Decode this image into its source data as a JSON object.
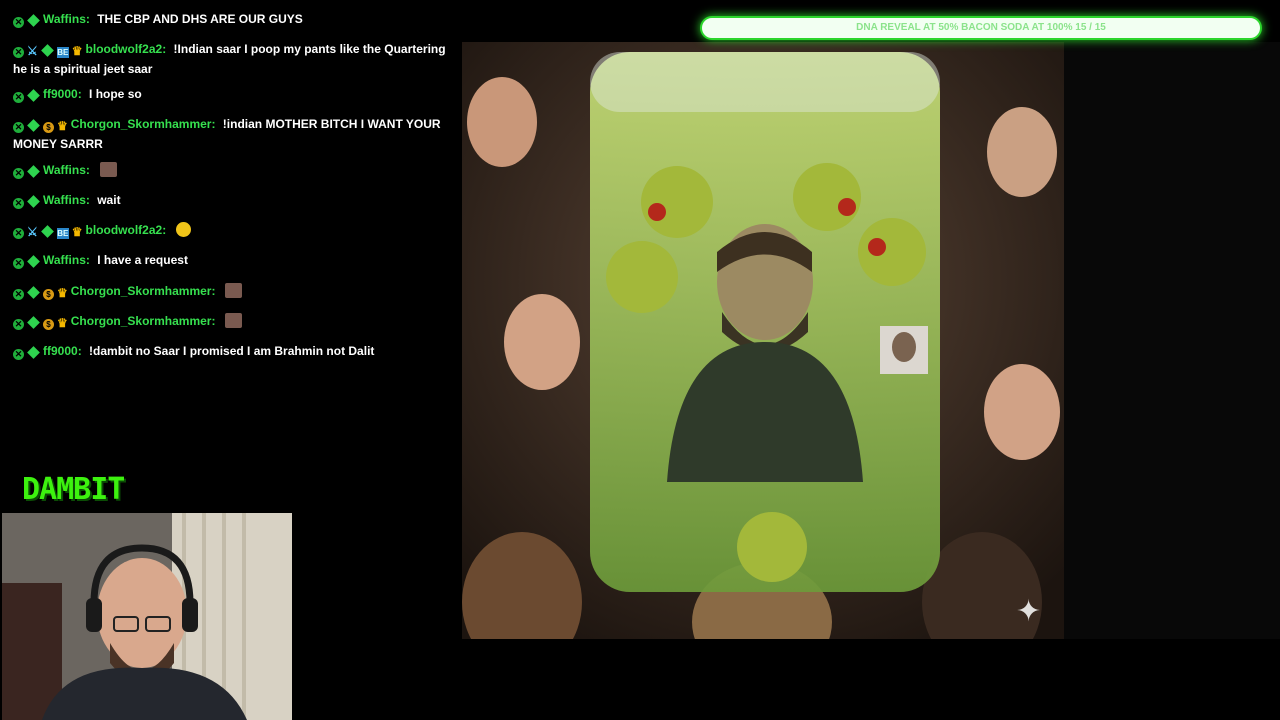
{
  "chat": [
    {
      "badges": [
        "x",
        "d"
      ],
      "user": "Waffins",
      "text": "THE CBP AND DHS ARE OUR GUYS"
    },
    {
      "badges": [
        "x",
        "sw",
        "d",
        "bot",
        "crown"
      ],
      "user": "bloodwolf2a2",
      "text": "!Indian saar I poop my pants like the Quartering he is a spiritual jeet saar"
    },
    {
      "badges": [
        "x",
        "d"
      ],
      "user": "ff9000",
      "text": "I hope so"
    },
    {
      "badges": [
        "x",
        "d",
        "coin",
        "crown"
      ],
      "user": "Chorgon_Skormhammer",
      "text": "!indian MOTHER BITCH I WANT YOUR MONEY SARRR"
    },
    {
      "badges": [
        "x",
        "d"
      ],
      "user": "Waffins",
      "text": "",
      "emote": "face-emote"
    },
    {
      "badges": [
        "x",
        "d"
      ],
      "user": "Waffins",
      "text": "wait"
    },
    {
      "badges": [
        "x",
        "sw",
        "d",
        "bot",
        "crown"
      ],
      "user": "bloodwolf2a2",
      "text": "",
      "emote": "laughing-emoji"
    },
    {
      "badges": [
        "x",
        "d"
      ],
      "user": "Waffins",
      "text": "I have a request"
    },
    {
      "badges": [
        "x",
        "d",
        "coin",
        "crown"
      ],
      "user": "Chorgon_Skormhammer",
      "text": "",
      "emote": "face-emote"
    },
    {
      "badges": [
        "x",
        "d",
        "coin",
        "crown"
      ],
      "user": "Chorgon_Skormhammer",
      "text": "",
      "emote": "face-emote"
    },
    {
      "badges": [
        "x",
        "d"
      ],
      "user": "ff9000",
      "text": "!dambit no Saar I promised I am Brahmin not Dalit"
    }
  ],
  "logo": "DAMBIT",
  "progress": {
    "label": "DNA REVEAL AT 50% BACON SODA AT 100% 15 / 15",
    "value": 1.0
  },
  "colors": {
    "username": "#36e04f",
    "logo": "#3df20f",
    "progress_border": "#2bd52b"
  }
}
